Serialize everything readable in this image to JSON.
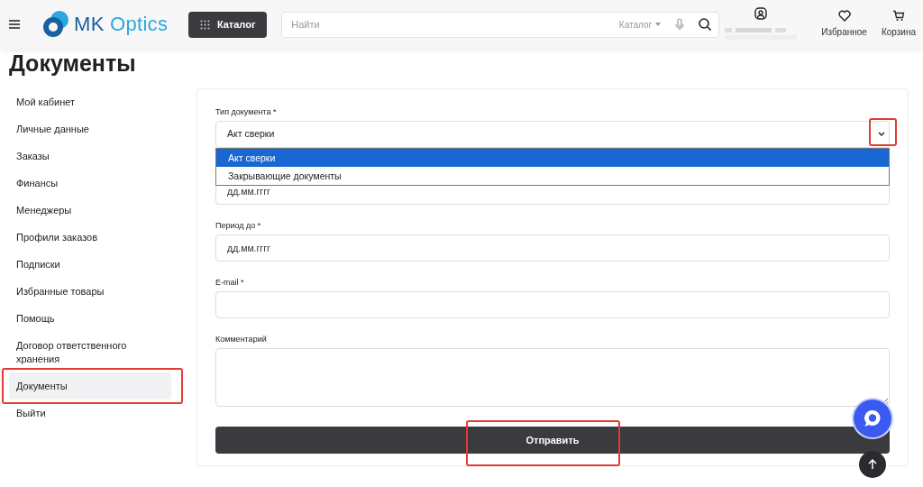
{
  "header": {
    "brand_mark": "MK",
    "brand_name": "Optics",
    "catalog_button": "Каталог",
    "search": {
      "placeholder": "Найти",
      "scope": "Каталог"
    },
    "actions": [
      {
        "kind": "account"
      },
      {
        "kind": "favorites",
        "label": "Избранное"
      },
      {
        "kind": "cart",
        "label": "Корзина"
      }
    ]
  },
  "page_title": "Документы",
  "sidebar": {
    "items": [
      {
        "label": "Мой кабинет",
        "selected": false,
        "highlighted": false
      },
      {
        "label": "Личные данные",
        "selected": false,
        "highlighted": false
      },
      {
        "label": "Заказы",
        "selected": false,
        "highlighted": false
      },
      {
        "label": "Финансы",
        "selected": false,
        "highlighted": false
      },
      {
        "label": "Менеджеры",
        "selected": false,
        "highlighted": false
      },
      {
        "label": "Профили заказов",
        "selected": false,
        "highlighted": false
      },
      {
        "label": "Подписки",
        "selected": false,
        "highlighted": false
      },
      {
        "label": "Избранные товары",
        "selected": false,
        "highlighted": false
      },
      {
        "label": "Помощь",
        "selected": false,
        "highlighted": false
      },
      {
        "label": "Договор ответственного хранения",
        "selected": false,
        "highlighted": false
      },
      {
        "label": "Документы",
        "selected": true,
        "highlighted": true
      },
      {
        "label": "Выйти",
        "selected": false,
        "highlighted": false
      }
    ]
  },
  "form": {
    "fields": [
      {
        "kind": "select",
        "label": "Тип документа *",
        "value": "Акт сверки",
        "expanded": true,
        "arrow_highlighted": true,
        "options": [
          {
            "label": "Акт сверки",
            "selected": true
          },
          {
            "label": "Закрывающие документы",
            "selected": false
          }
        ]
      },
      {
        "kind": "date",
        "placeholder": "дд.мм.гггг"
      },
      {
        "kind": "date",
        "label": "Период до *",
        "placeholder": "дд.мм.гггг"
      },
      {
        "kind": "text",
        "label": "E-mail *"
      },
      {
        "kind": "textarea",
        "label": "Комментарий"
      }
    ],
    "submit": {
      "label": "Отправить",
      "highlighted": true
    }
  }
}
